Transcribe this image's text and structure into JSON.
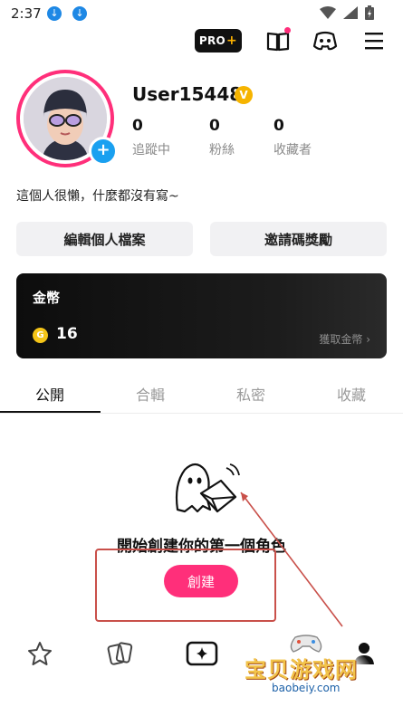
{
  "status_bar": {
    "time": "2:37"
  },
  "header": {
    "pro_label": "PRO",
    "pro_plus": "+"
  },
  "profile": {
    "username": "User15448",
    "verified_mark": "V",
    "stats": [
      {
        "value": "0",
        "label": "追蹤中"
      },
      {
        "value": "0",
        "label": "粉絲"
      },
      {
        "value": "0",
        "label": "收藏者"
      }
    ],
    "bio": "這個人很懶，什麼都沒有寫~",
    "edit_button": "編輯個人檔案",
    "invite_button": "邀請碼獎勵"
  },
  "coins": {
    "title": "金幣",
    "icon_letter": "G",
    "balance": "16",
    "get_link": "獲取金幣 ›"
  },
  "tabs": [
    {
      "label": "公開",
      "active": true
    },
    {
      "label": "合輯",
      "active": false
    },
    {
      "label": "私密",
      "active": false
    },
    {
      "label": "收藏",
      "active": false
    }
  ],
  "empty_state": {
    "title": "開始創建你的第一個角色",
    "create_button": "創建"
  },
  "watermark": {
    "text": "宝贝游戏网",
    "url": "baobeiy.com"
  },
  "colors": {
    "accent": "#ff2f7a",
    "blue": "#1aa0f0",
    "gold": "#f6b400",
    "annotation": "#c9504a"
  }
}
